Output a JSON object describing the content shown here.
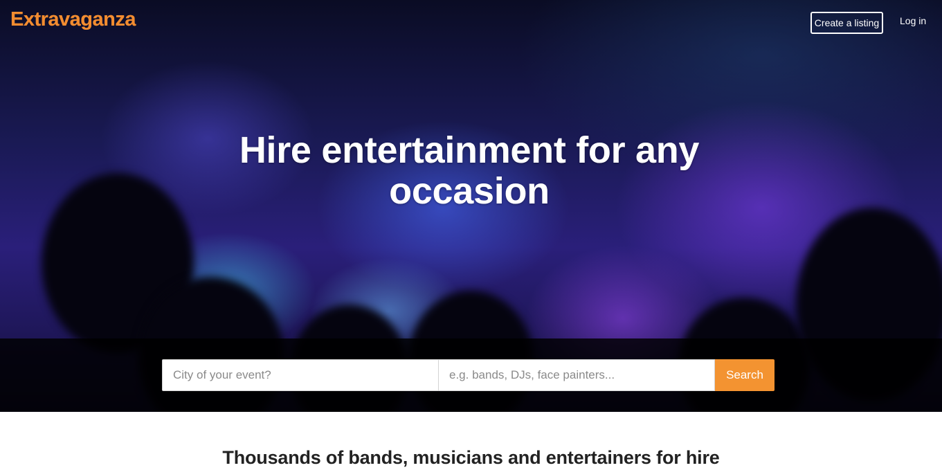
{
  "brand": {
    "name": "Extravaganza",
    "color": "#f28c30"
  },
  "nav": {
    "create_listing": "Create a listing",
    "log_in": "Log in"
  },
  "hero": {
    "headline": "Hire entertainment for any occasion"
  },
  "search": {
    "city_placeholder": "City of your event?",
    "what_placeholder": "e.g. bands, DJs, face painters...",
    "button_label": "Search",
    "button_color": "#f39331"
  },
  "section": {
    "heading": "Thousands of bands, musicians and entertainers for hire"
  }
}
